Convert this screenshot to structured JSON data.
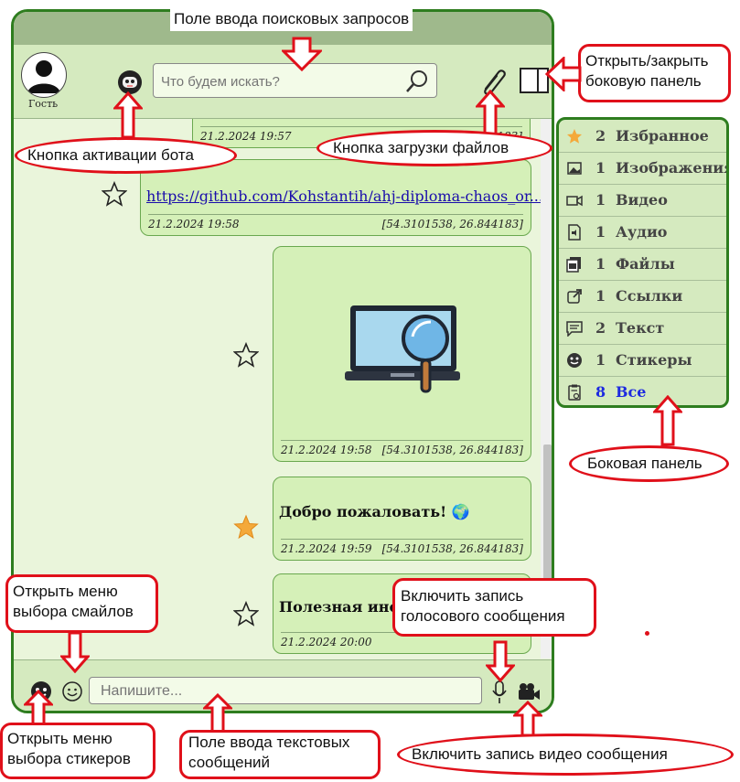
{
  "header": {
    "guest_label": "Гость",
    "search_placeholder": "Что будем искать?"
  },
  "messages": [
    {
      "date": "21.2.2024 19:57",
      "coords": "[54.3101538, 26.844183]"
    },
    {
      "link": "https://github.com/Kohstantih/ahj-diploma-chaos_or...",
      "date": "21.2.2024 19:58",
      "coords": "[54.3101538, 26.844183]",
      "starred": false
    },
    {
      "type": "image",
      "date": "21.2.2024 19:58",
      "coords": "[54.3101538, 26.844183]",
      "starred": false
    },
    {
      "text": "Добро пожаловать! 🌍",
      "date": "21.2.2024 19:59",
      "coords": "[54.3101538, 26.844183]",
      "starred": true
    },
    {
      "text": "Полезная инфо",
      "date": "21.2.2024 20:00",
      "coords": "",
      "starred": false
    }
  ],
  "footer": {
    "input_placeholder": "Напишите..."
  },
  "sidebar": {
    "items": [
      {
        "icon": "star-icon",
        "count": "2",
        "label": "Избранное"
      },
      {
        "icon": "image-icon",
        "count": "1",
        "label": "Изображения"
      },
      {
        "icon": "video-icon",
        "count": "1",
        "label": "Видео"
      },
      {
        "icon": "audio-icon",
        "count": "1",
        "label": "Аудио"
      },
      {
        "icon": "files-icon",
        "count": "1",
        "label": "Файлы"
      },
      {
        "icon": "external-link-icon",
        "count": "1",
        "label": "Ссылки"
      },
      {
        "icon": "text-icon",
        "count": "2",
        "label": "Текст"
      },
      {
        "icon": "sticker-icon",
        "count": "1",
        "label": "Стикеры"
      },
      {
        "icon": "all-icon",
        "count": "8",
        "label": "Все"
      }
    ]
  },
  "annotations": {
    "search_field": "Поле ввода поисковых запросов",
    "bot_button": "Кнопка активации бота",
    "upload_button": "Кнопка загрузки файлов",
    "toggle_panel": "Открыть/закрыть боковую панель",
    "sidebar": "Боковая панель",
    "emoji_menu": "Открыть меню выбора смайлов",
    "sticker_menu": "Открыть меню выбора стикеров",
    "text_input": "Поле ввода текстовых сообщений",
    "voice_record": "Включить запись голосового сообщения",
    "video_record": "Включить запись  видео сообщения"
  },
  "colors": {
    "frame_green": "#2e7d1f",
    "message_bg": "#d5f0b8",
    "callout_red": "#e0101a",
    "star_gold": "#f4a93a"
  }
}
